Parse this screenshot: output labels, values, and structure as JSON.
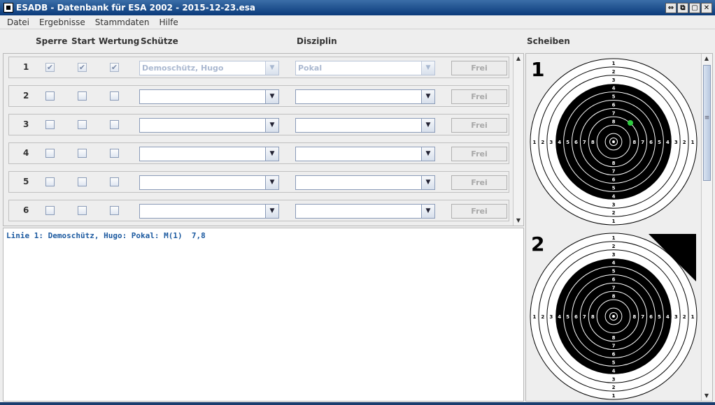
{
  "window": {
    "title": "ESADB - Datenbank für ESA 2002 - 2015-12-23.esa"
  },
  "menu": [
    "Datei",
    "Ergebnisse",
    "Stammdaten",
    "Hilfe"
  ],
  "columns": {
    "sperre": "Sperre",
    "start": "Start",
    "wertung": "Wertung",
    "schuetze": "Schütze",
    "disziplin": "Disziplin",
    "scheiben": "Scheiben"
  },
  "lines": [
    {
      "number": "1",
      "sperre": true,
      "start": true,
      "wertung": true,
      "schuetze": "Demoschütz, Hugo",
      "disziplin": "Pokal",
      "button": "Frei",
      "enabled": false
    },
    {
      "number": "2",
      "sperre": false,
      "start": false,
      "wertung": false,
      "schuetze": "",
      "disziplin": "",
      "button": "Frei",
      "enabled": true
    },
    {
      "number": "3",
      "sperre": false,
      "start": false,
      "wertung": false,
      "schuetze": "",
      "disziplin": "",
      "button": "Frei",
      "enabled": true
    },
    {
      "number": "4",
      "sperre": false,
      "start": false,
      "wertung": false,
      "schuetze": "",
      "disziplin": "",
      "button": "Frei",
      "enabled": true
    },
    {
      "number": "5",
      "sperre": false,
      "start": false,
      "wertung": false,
      "schuetze": "",
      "disziplin": "",
      "button": "Frei",
      "enabled": true
    },
    {
      "number": "6",
      "sperre": false,
      "start": false,
      "wertung": false,
      "schuetze": "",
      "disziplin": "",
      "button": "Frei",
      "enabled": true
    }
  ],
  "log": [
    "Linie 1: Demoschütz, Hugo: Pokal: M(1)  7,8"
  ],
  "targets": [
    {
      "number": "1",
      "shot": true,
      "shot_color": "#2ecc40"
    },
    {
      "number": "2",
      "shot": false,
      "corner_marker": true
    }
  ],
  "ring_labels": [
    "1",
    "2",
    "3",
    "4",
    "5",
    "6",
    "7",
    "8"
  ],
  "icons": {
    "checked": "✔",
    "dropdown": "▼",
    "scroll_up": "▲",
    "scroll_down": "▼",
    "window_buttons": [
      "⇔",
      "⧉",
      "▢",
      "✕"
    ]
  }
}
